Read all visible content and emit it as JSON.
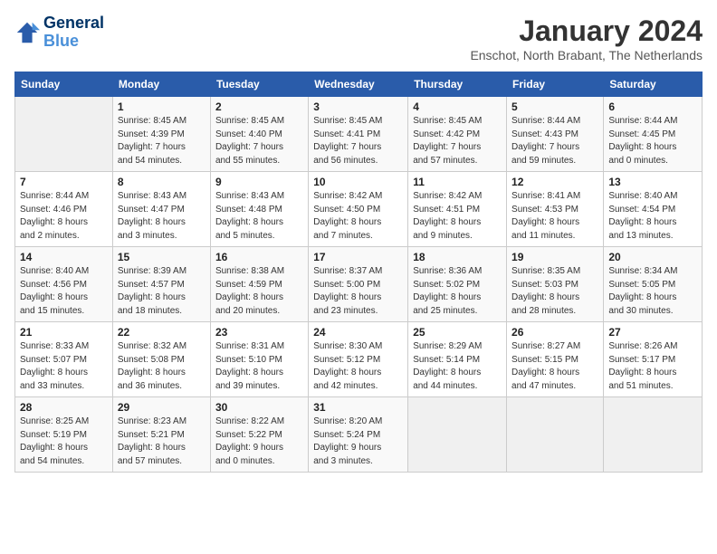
{
  "header": {
    "logo_line1": "General",
    "logo_line2": "Blue",
    "title": "January 2024",
    "subtitle": "Enschot, North Brabant, The Netherlands"
  },
  "days_of_week": [
    "Sunday",
    "Monday",
    "Tuesday",
    "Wednesday",
    "Thursday",
    "Friday",
    "Saturday"
  ],
  "weeks": [
    [
      {
        "day": "",
        "detail": ""
      },
      {
        "day": "1",
        "detail": "Sunrise: 8:45 AM\nSunset: 4:39 PM\nDaylight: 7 hours\nand 54 minutes."
      },
      {
        "day": "2",
        "detail": "Sunrise: 8:45 AM\nSunset: 4:40 PM\nDaylight: 7 hours\nand 55 minutes."
      },
      {
        "day": "3",
        "detail": "Sunrise: 8:45 AM\nSunset: 4:41 PM\nDaylight: 7 hours\nand 56 minutes."
      },
      {
        "day": "4",
        "detail": "Sunrise: 8:45 AM\nSunset: 4:42 PM\nDaylight: 7 hours\nand 57 minutes."
      },
      {
        "day": "5",
        "detail": "Sunrise: 8:44 AM\nSunset: 4:43 PM\nDaylight: 7 hours\nand 59 minutes."
      },
      {
        "day": "6",
        "detail": "Sunrise: 8:44 AM\nSunset: 4:45 PM\nDaylight: 8 hours\nand 0 minutes."
      }
    ],
    [
      {
        "day": "7",
        "detail": "Sunrise: 8:44 AM\nSunset: 4:46 PM\nDaylight: 8 hours\nand 2 minutes."
      },
      {
        "day": "8",
        "detail": "Sunrise: 8:43 AM\nSunset: 4:47 PM\nDaylight: 8 hours\nand 3 minutes."
      },
      {
        "day": "9",
        "detail": "Sunrise: 8:43 AM\nSunset: 4:48 PM\nDaylight: 8 hours\nand 5 minutes."
      },
      {
        "day": "10",
        "detail": "Sunrise: 8:42 AM\nSunset: 4:50 PM\nDaylight: 8 hours\nand 7 minutes."
      },
      {
        "day": "11",
        "detail": "Sunrise: 8:42 AM\nSunset: 4:51 PM\nDaylight: 8 hours\nand 9 minutes."
      },
      {
        "day": "12",
        "detail": "Sunrise: 8:41 AM\nSunset: 4:53 PM\nDaylight: 8 hours\nand 11 minutes."
      },
      {
        "day": "13",
        "detail": "Sunrise: 8:40 AM\nSunset: 4:54 PM\nDaylight: 8 hours\nand 13 minutes."
      }
    ],
    [
      {
        "day": "14",
        "detail": "Sunrise: 8:40 AM\nSunset: 4:56 PM\nDaylight: 8 hours\nand 15 minutes."
      },
      {
        "day": "15",
        "detail": "Sunrise: 8:39 AM\nSunset: 4:57 PM\nDaylight: 8 hours\nand 18 minutes."
      },
      {
        "day": "16",
        "detail": "Sunrise: 8:38 AM\nSunset: 4:59 PM\nDaylight: 8 hours\nand 20 minutes."
      },
      {
        "day": "17",
        "detail": "Sunrise: 8:37 AM\nSunset: 5:00 PM\nDaylight: 8 hours\nand 23 minutes."
      },
      {
        "day": "18",
        "detail": "Sunrise: 8:36 AM\nSunset: 5:02 PM\nDaylight: 8 hours\nand 25 minutes."
      },
      {
        "day": "19",
        "detail": "Sunrise: 8:35 AM\nSunset: 5:03 PM\nDaylight: 8 hours\nand 28 minutes."
      },
      {
        "day": "20",
        "detail": "Sunrise: 8:34 AM\nSunset: 5:05 PM\nDaylight: 8 hours\nand 30 minutes."
      }
    ],
    [
      {
        "day": "21",
        "detail": "Sunrise: 8:33 AM\nSunset: 5:07 PM\nDaylight: 8 hours\nand 33 minutes."
      },
      {
        "day": "22",
        "detail": "Sunrise: 8:32 AM\nSunset: 5:08 PM\nDaylight: 8 hours\nand 36 minutes."
      },
      {
        "day": "23",
        "detail": "Sunrise: 8:31 AM\nSunset: 5:10 PM\nDaylight: 8 hours\nand 39 minutes."
      },
      {
        "day": "24",
        "detail": "Sunrise: 8:30 AM\nSunset: 5:12 PM\nDaylight: 8 hours\nand 42 minutes."
      },
      {
        "day": "25",
        "detail": "Sunrise: 8:29 AM\nSunset: 5:14 PM\nDaylight: 8 hours\nand 44 minutes."
      },
      {
        "day": "26",
        "detail": "Sunrise: 8:27 AM\nSunset: 5:15 PM\nDaylight: 8 hours\nand 47 minutes."
      },
      {
        "day": "27",
        "detail": "Sunrise: 8:26 AM\nSunset: 5:17 PM\nDaylight: 8 hours\nand 51 minutes."
      }
    ],
    [
      {
        "day": "28",
        "detail": "Sunrise: 8:25 AM\nSunset: 5:19 PM\nDaylight: 8 hours\nand 54 minutes."
      },
      {
        "day": "29",
        "detail": "Sunrise: 8:23 AM\nSunset: 5:21 PM\nDaylight: 8 hours\nand 57 minutes."
      },
      {
        "day": "30",
        "detail": "Sunrise: 8:22 AM\nSunset: 5:22 PM\nDaylight: 9 hours\nand 0 minutes."
      },
      {
        "day": "31",
        "detail": "Sunrise: 8:20 AM\nSunset: 5:24 PM\nDaylight: 9 hours\nand 3 minutes."
      },
      {
        "day": "",
        "detail": ""
      },
      {
        "day": "",
        "detail": ""
      },
      {
        "day": "",
        "detail": ""
      }
    ]
  ]
}
